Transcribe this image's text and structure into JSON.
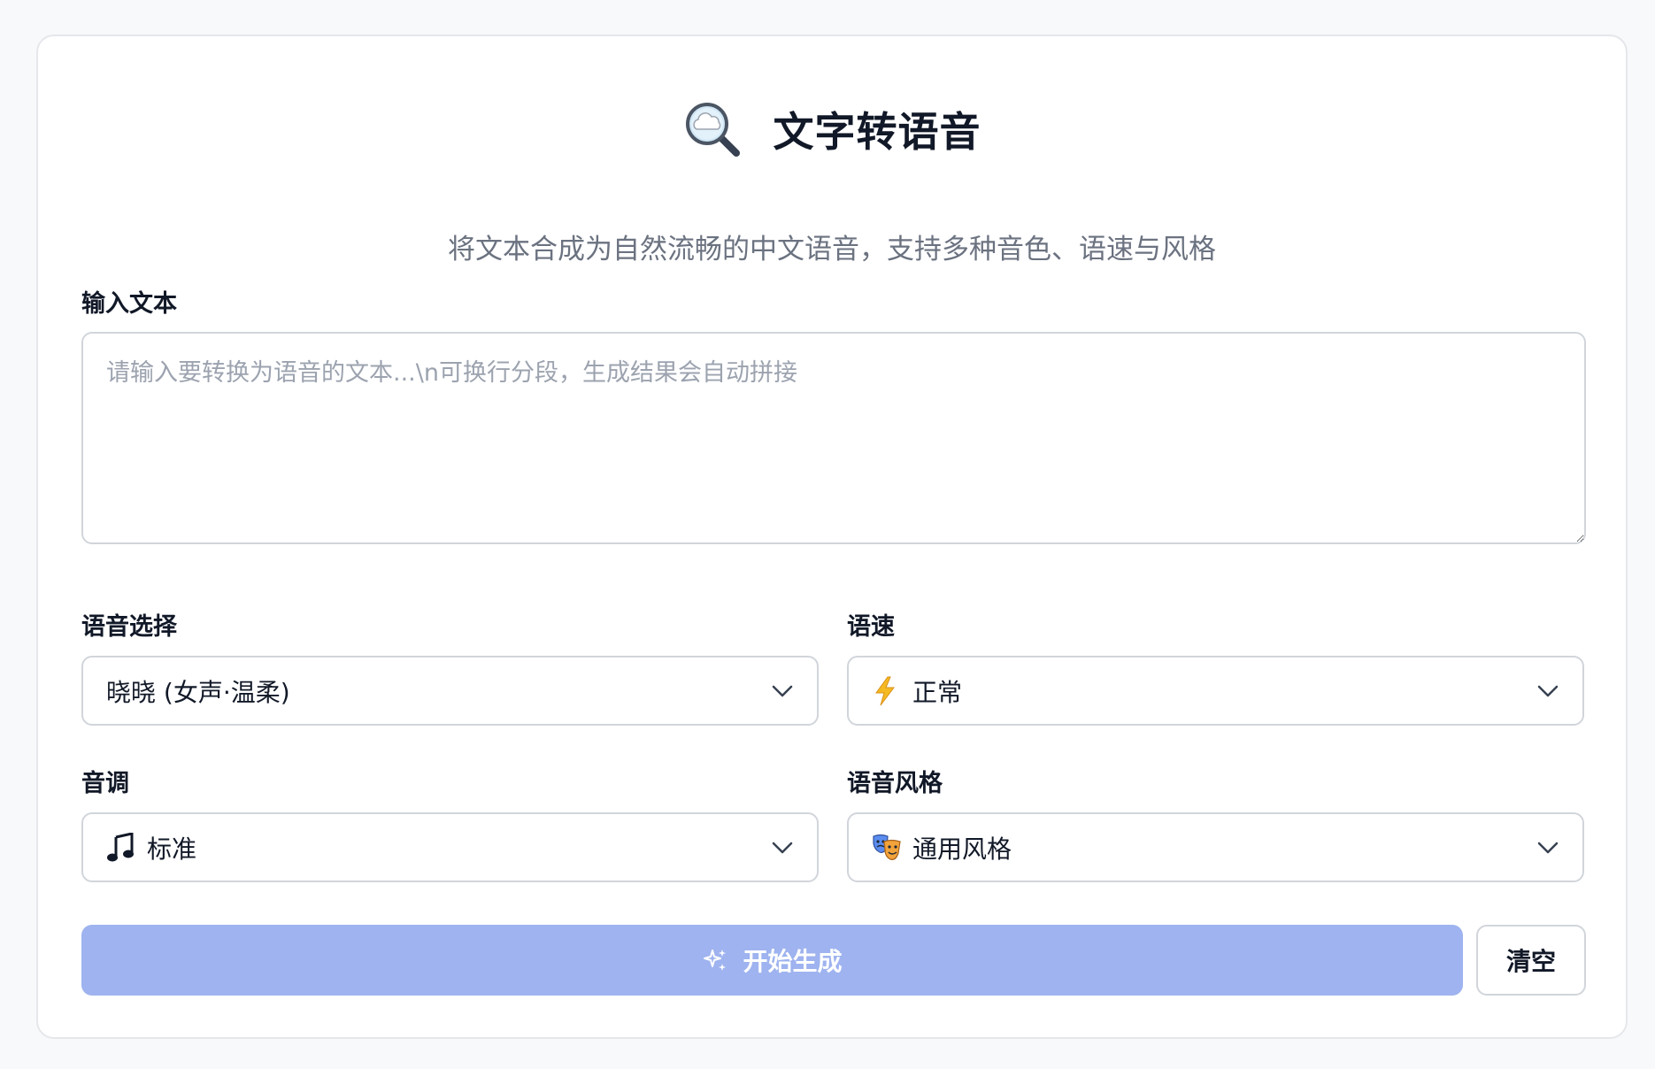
{
  "header": {
    "icon": "magnifier-cloud-icon",
    "title": "文字转语音",
    "subtitle": "将文本合成为自然流畅的中文语音，支持多种音色、语速与风格"
  },
  "input": {
    "label": "输入文本",
    "value": "",
    "placeholder": "请输入要转换为语音的文本...\\n可换行分段，生成结果会自动拼接"
  },
  "voice": {
    "label": "语音选择",
    "selected": "晓晓 (女声·温柔)"
  },
  "speed": {
    "label": "语速",
    "icon": "lightning-icon",
    "selected": "正常"
  },
  "pitch": {
    "label": "音调",
    "icon": "music-note-icon",
    "selected": "标准"
  },
  "style": {
    "label": "语音风格",
    "icon": "theater-masks-icon",
    "selected": "通用风格"
  },
  "actions": {
    "generate_icon": "sparkles-icon",
    "generate_label": "开始生成",
    "clear_label": "清空"
  },
  "colors": {
    "primary_disabled": "#9eb3ef",
    "border": "#d1d5db",
    "muted_text": "#6b7280"
  }
}
